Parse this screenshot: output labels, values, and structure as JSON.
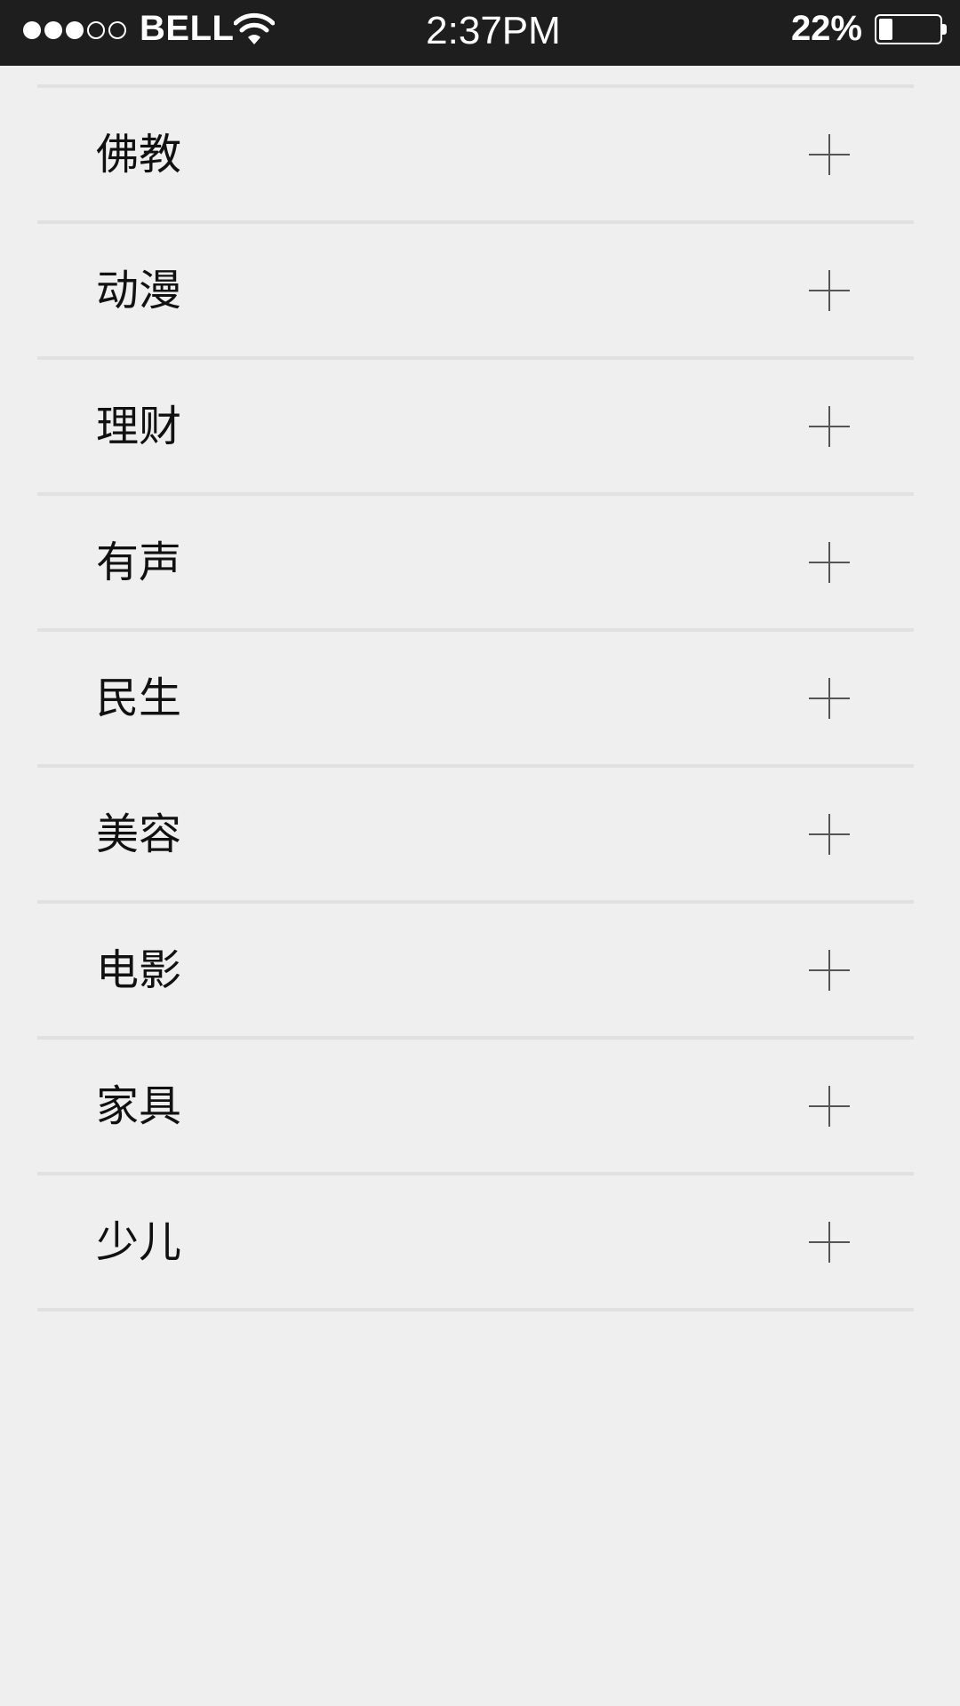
{
  "status_bar": {
    "carrier": "BELL",
    "time": "2:37PM",
    "battery_percent": "22%",
    "battery_level": 0.22,
    "signal_bars_filled": 3,
    "signal_bars_total": 5,
    "background_color": "#1e1e1e"
  },
  "category_list": {
    "items": [
      {
        "label": "佛教",
        "action_icon": "plus-icon"
      },
      {
        "label": "动漫",
        "action_icon": "plus-icon"
      },
      {
        "label": "理财",
        "action_icon": "plus-icon"
      },
      {
        "label": "有声",
        "action_icon": "plus-icon"
      },
      {
        "label": "民生",
        "action_icon": "plus-icon"
      },
      {
        "label": "美容",
        "action_icon": "plus-icon"
      },
      {
        "label": "电影",
        "action_icon": "plus-icon"
      },
      {
        "label": "家具",
        "action_icon": "plus-icon"
      },
      {
        "label": "少儿",
        "action_icon": "plus-icon"
      }
    ]
  },
  "colors": {
    "page_background": "#efefef",
    "divider": "#e1e1e1",
    "text": "#111111",
    "icon": "#555555"
  }
}
